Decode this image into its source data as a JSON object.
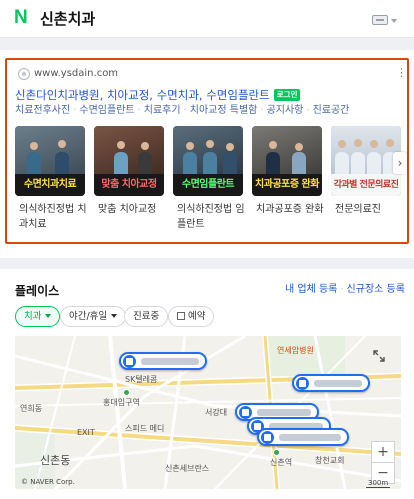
{
  "header": {
    "logo_letter": "N",
    "query": "신촌치과"
  },
  "ad": {
    "url": "www.ysdain.com",
    "more": "⋮",
    "title": "신촌다인치과병원, 치아교정, 수면치과, 수면임플란트",
    "badge": "로그인",
    "links": [
      "치료전후사진",
      "수면임플란트",
      "치료후기",
      "치아교정 특별함",
      "공지사항",
      "진료공간"
    ],
    "cards": [
      {
        "caption": "수면치과치료",
        "label": "의식하진정법 치과치료"
      },
      {
        "caption": "맞춤 치아교정",
        "label": "맞춤 치아교정"
      },
      {
        "caption": "수면임플란트",
        "label": "의식하진정법 임플란트"
      },
      {
        "caption": "치과공포증 완화",
        "label": "치과공포증 완화"
      },
      {
        "caption": "각과별 전문의료진",
        "label": "전문의료진"
      }
    ],
    "next": "›"
  },
  "place": {
    "title": "플레이스",
    "links": [
      "내 업체 등록",
      "신규장소 등록"
    ],
    "chips": [
      {
        "label": "치과",
        "active": true
      },
      {
        "label": "야간/휴일",
        "active": false
      },
      {
        "label": "진료중",
        "active": false
      },
      {
        "label": "예약",
        "active": false
      }
    ]
  },
  "map": {
    "labels": {
      "sk": "SK텔레콤",
      "hongik": "홍대입구역",
      "yonsei": "연세암병원",
      "sinchon_st": "신촌역",
      "sinchon_big": "신촌동",
      "changcheon": "창천동",
      "changcheon_ch": "창천교회",
      "exit": "EXIT",
      "seogang": "서강대",
      "starbucks": "스피드 메디",
      "yeonhui": "연희동",
      "hospital": "신촌세브란스"
    },
    "attribution": "© NAVER Corp.",
    "scale": "300m",
    "zoom_in": "+",
    "zoom_out": "−"
  }
}
